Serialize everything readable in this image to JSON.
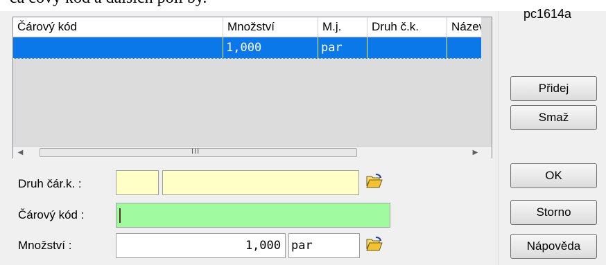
{
  "window": {
    "top_text_fragment": "ča čový kód a dalších polí by.",
    "form_code": "pc1614a"
  },
  "grid": {
    "columns": [
      {
        "label": "Čárový kód"
      },
      {
        "label": "Množství"
      },
      {
        "label": "M.j."
      },
      {
        "label": "Druh č.k."
      },
      {
        "label": "Název"
      }
    ],
    "rows": [
      {
        "barcode": "",
        "quantity": "1,000",
        "unit": "par",
        "type": "",
        "name": ""
      }
    ],
    "hscroll_grip": "III"
  },
  "form": {
    "barcode_type_label": "Druh čár.k. :",
    "barcode_label": "Čárový kód :",
    "quantity_label": "Množství :",
    "quantity_value": "1,000",
    "unit_value": "par"
  },
  "buttons": {
    "add": "Přidej",
    "delete": "Smaž",
    "ok": "OK",
    "cancel": "Storno",
    "help": "Nápověda"
  },
  "colors": {
    "selection": "#0a78e8",
    "lookup_field": "#ffffc6",
    "active_field": "#a0faa0",
    "folder_icon": "#f2c230"
  }
}
